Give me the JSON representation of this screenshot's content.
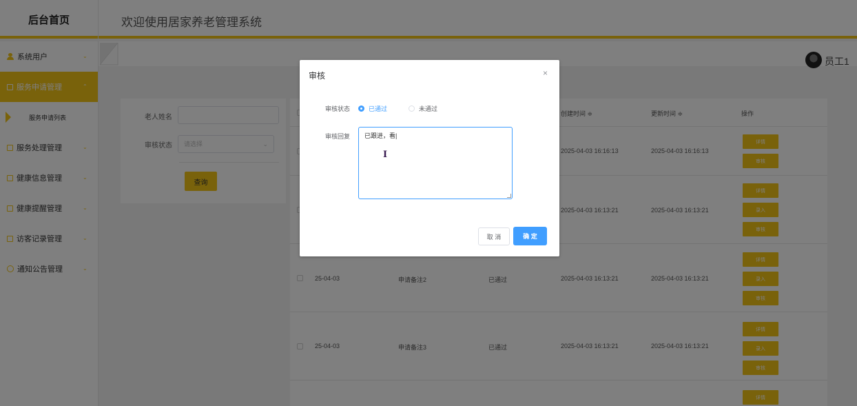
{
  "header": {
    "brand": "后台首页",
    "welcome": "欢迎使用居家养老管理系统"
  },
  "user": {
    "name": "员工1"
  },
  "sidebar": {
    "items": [
      {
        "label": "系统用户",
        "icon": "user-icon",
        "chevron": "⌄"
      },
      {
        "label": "服务申请管理",
        "icon": "square-icon",
        "chevron": "⌃",
        "active": true
      },
      {
        "label": "服务申请列表",
        "sub": true
      },
      {
        "label": "服务处理管理",
        "icon": "square-icon",
        "chevron": "⌄"
      },
      {
        "label": "健康信息管理",
        "icon": "square-icon",
        "chevron": "⌄"
      },
      {
        "label": "健康提醒管理",
        "icon": "square-icon",
        "chevron": "⌄"
      },
      {
        "label": "访客记录管理",
        "icon": "square-icon",
        "chevron": "⌄"
      },
      {
        "label": "通知公告管理",
        "icon": "info-icon",
        "chevron": "⌄"
      }
    ]
  },
  "search": {
    "name_label": "老人姓名",
    "status_label": "审核状态",
    "status_placeholder": "请选择",
    "query_label": "查询"
  },
  "table": {
    "headers": {
      "created": "创建时间 ≑",
      "updated": "更新时间 ≑",
      "ops": "操作"
    },
    "rows": [
      {
        "date": "",
        "note": "",
        "status": "",
        "created": "2025-04-03 16:16:13",
        "updated": "2025-04-03 16:16:13",
        "ops": [
          "详情",
          "审核"
        ]
      },
      {
        "date": "",
        "note": "",
        "status": "",
        "created": "2025-04-03 16:13:21",
        "updated": "2025-04-03 16:13:21",
        "ops": [
          "详情",
          "录入",
          "审核"
        ]
      },
      {
        "date": "25-04-03",
        "note": "申请备注2",
        "status": "已通过",
        "created": "2025-04-03 16:13:21",
        "updated": "2025-04-03 16:13:21",
        "ops": [
          "详情",
          "录入",
          "审核"
        ]
      },
      {
        "date": "25-04-03",
        "note": "申请备注3",
        "status": "已通过",
        "created": "2025-04-03 16:13:21",
        "updated": "2025-04-03 16:13:21",
        "ops": [
          "详情",
          "录入",
          "审核"
        ]
      },
      {
        "date": "",
        "note": "",
        "status": "",
        "created": "",
        "updated": "",
        "ops": [
          "详情"
        ]
      }
    ]
  },
  "dialog": {
    "title": "审核",
    "close": "×",
    "status_label": "审核状态",
    "option_pass": "已通过",
    "option_fail": "未通过",
    "reply_label": "审核回复",
    "reply_value": "已跟进，看|",
    "cursor": "I",
    "cancel": "取 消",
    "ok": "确 定"
  },
  "colors": {
    "accent": "#f2c417",
    "primary": "#409eff"
  }
}
